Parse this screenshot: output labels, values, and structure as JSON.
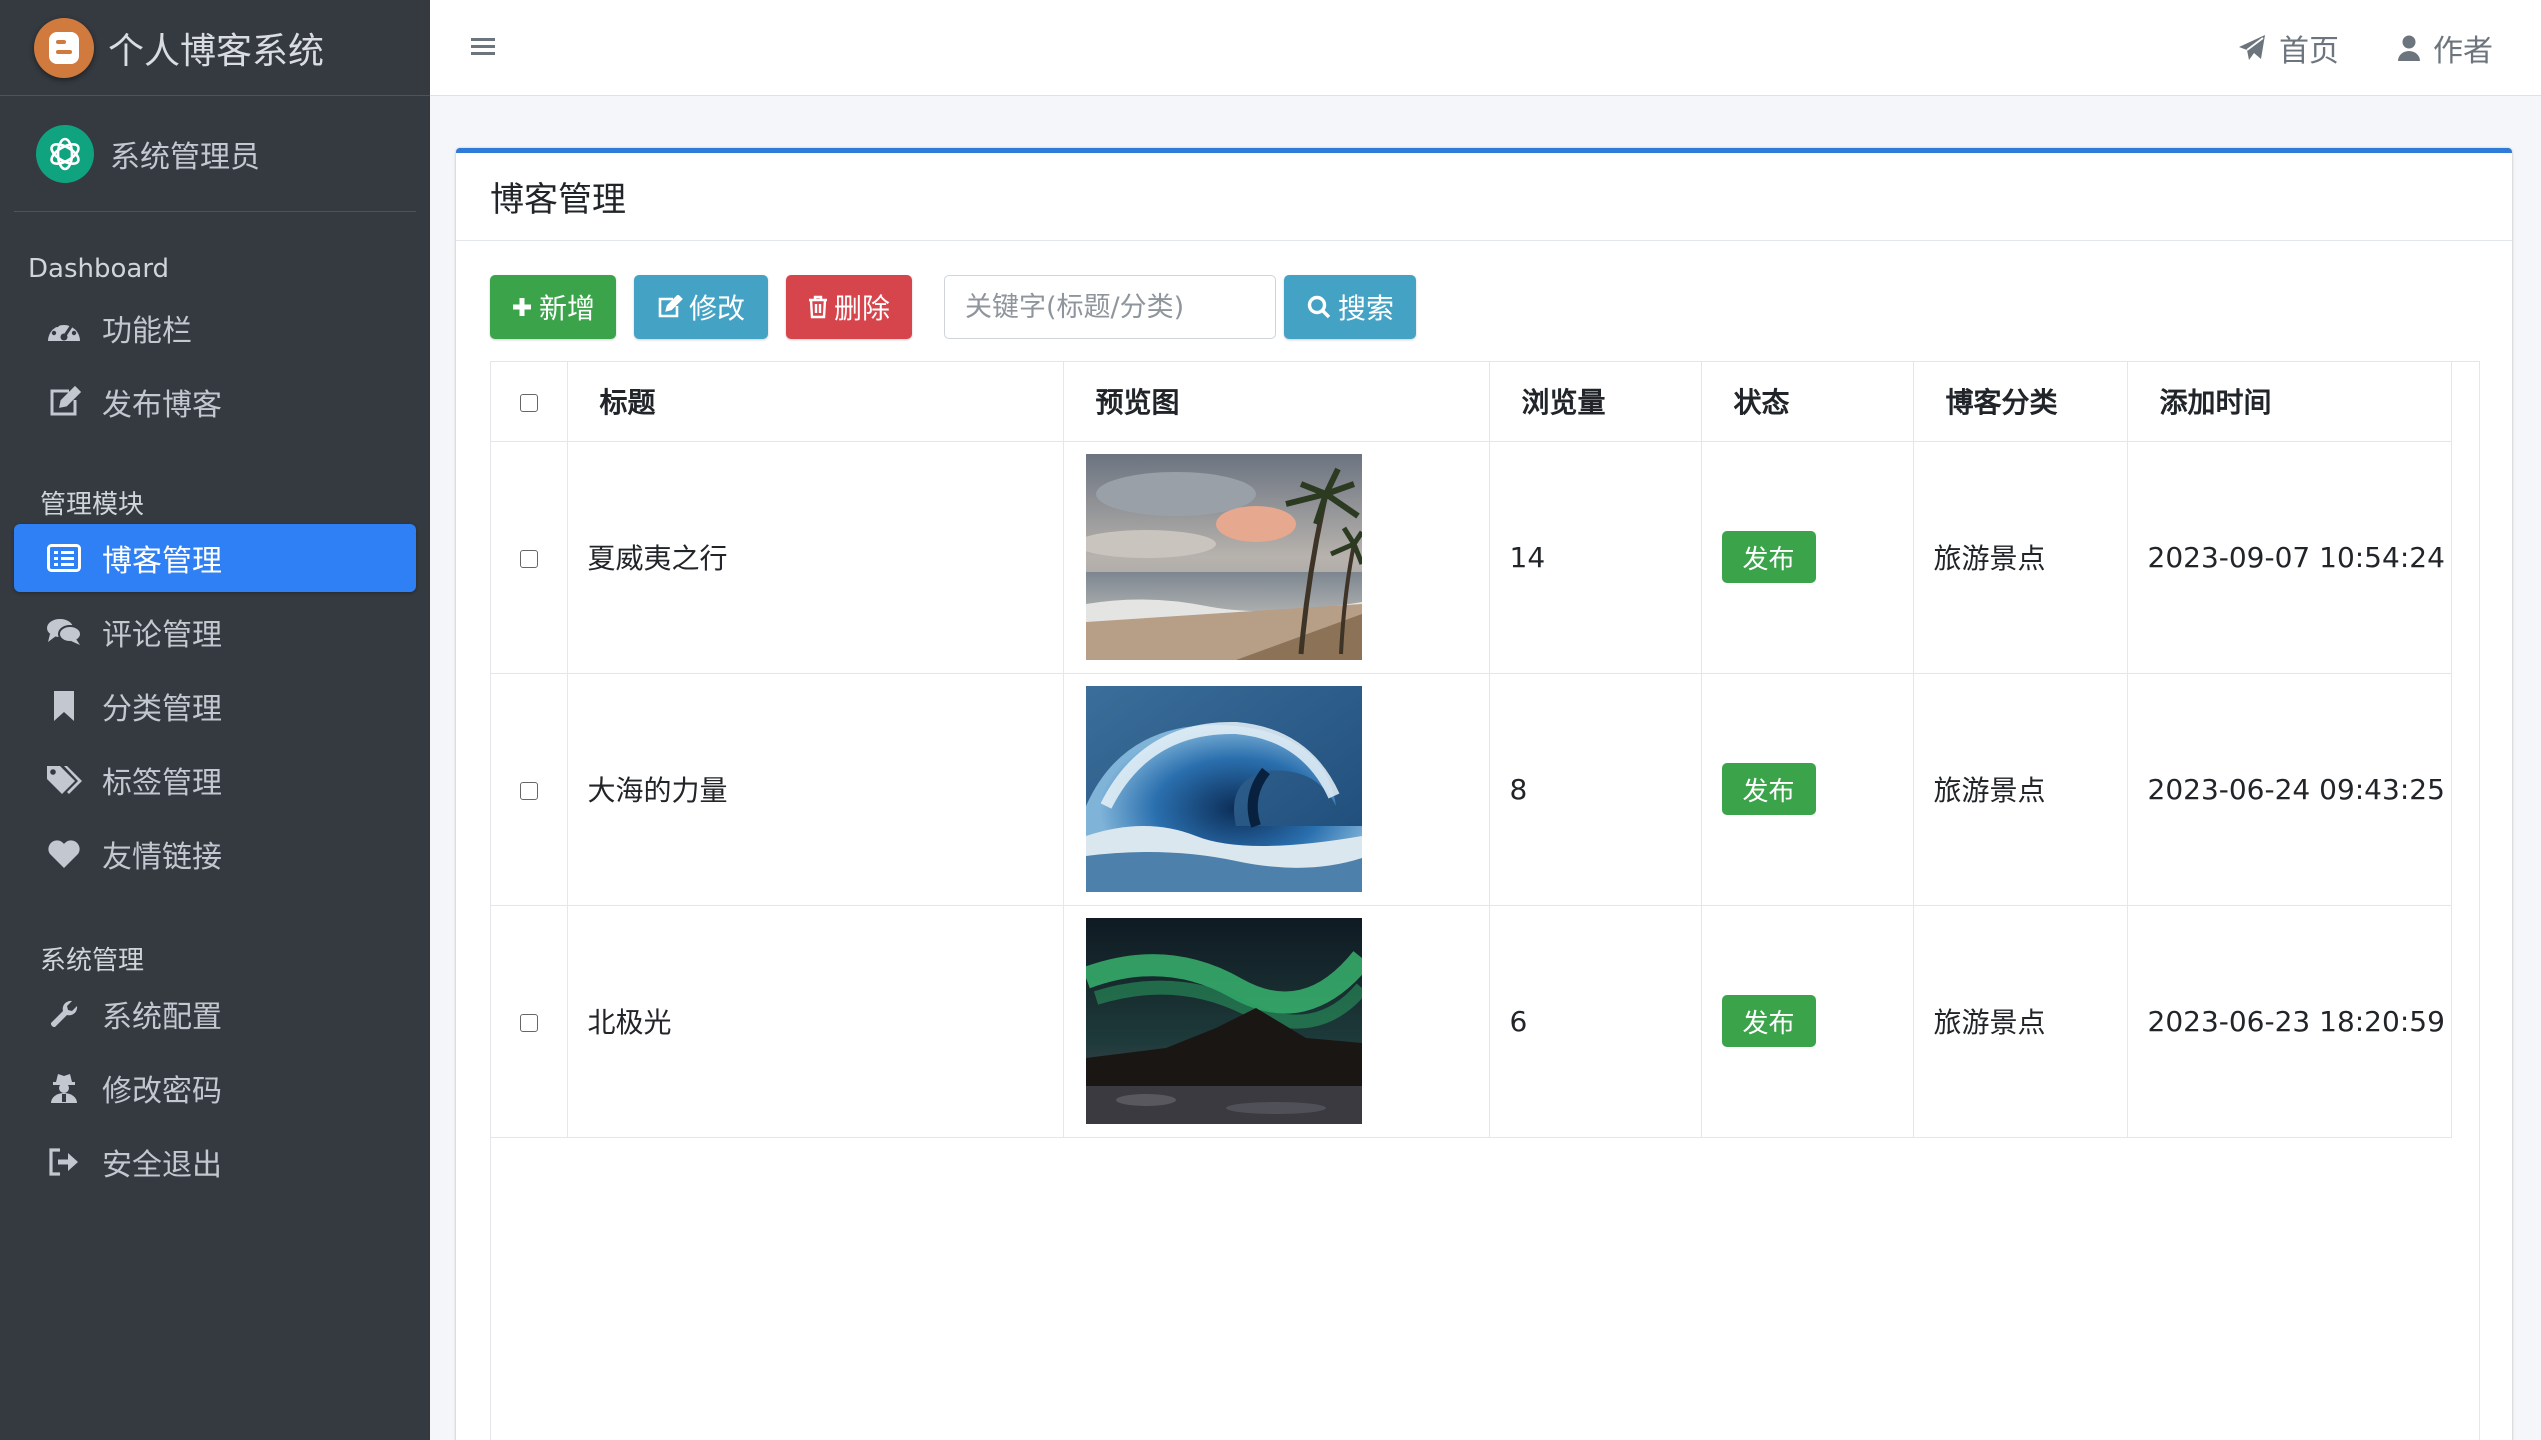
{
  "brand": {
    "title": "个人博客系统",
    "logo_icon": "blogger-icon"
  },
  "user": {
    "name": "系统管理员",
    "avatar_icon": "openai-logo-icon"
  },
  "sidebar": {
    "sections": [
      {
        "header": "Dashboard",
        "items": [
          {
            "label": "功能栏",
            "icon": "dashboard-icon"
          },
          {
            "label": "发布博客",
            "icon": "edit-icon"
          }
        ]
      },
      {
        "header": "管理模块",
        "items": [
          {
            "label": "博客管理",
            "icon": "list-icon",
            "active": true
          },
          {
            "label": "评论管理",
            "icon": "comments-icon"
          },
          {
            "label": "分类管理",
            "icon": "bookmark-icon"
          },
          {
            "label": "标签管理",
            "icon": "tags-icon"
          },
          {
            "label": "友情链接",
            "icon": "heart-icon"
          }
        ]
      },
      {
        "header": "系统管理",
        "items": [
          {
            "label": "系统配置",
            "icon": "wrench-icon"
          },
          {
            "label": "修改密码",
            "icon": "user-secret-icon"
          },
          {
            "label": "安全退出",
            "icon": "sign-out-icon"
          }
        ]
      }
    ]
  },
  "topbar": {
    "menu_icon": "bars-icon",
    "links": [
      {
        "label": "首页",
        "icon": "paper-plane-icon"
      },
      {
        "label": "作者",
        "icon": "user-icon"
      }
    ]
  },
  "card": {
    "title": "博客管理",
    "toolbar": {
      "add_label": "新增",
      "edit_label": "修改",
      "delete_label": "删除",
      "search_placeholder": "关键字(标题/分类)",
      "search_value": "",
      "search_label": "搜索"
    },
    "table": {
      "columns": [
        "标题",
        "预览图",
        "浏览量",
        "状态",
        "博客分类",
        "添加时间"
      ],
      "rows": [
        {
          "title": "夏威夷之行",
          "image": "beach-palm-trees-photo",
          "views": "14",
          "status": "发布",
          "category": "旅游景点",
          "created": "2023-09-07 10:54:24"
        },
        {
          "title": "大海的力量",
          "image": "ocean-wave-photo",
          "views": "8",
          "status": "发布",
          "category": "旅游景点",
          "created": "2023-06-24 09:43:25"
        },
        {
          "title": "北极光",
          "image": "aurora-night-photo",
          "views": "6",
          "status": "发布",
          "category": "旅游景点",
          "created": "2023-06-23 18:20:59"
        }
      ]
    }
  },
  "colors": {
    "sidebar_bg": "#343a40",
    "active_item": "#2f80f4",
    "success": "#3ba44a",
    "info": "#44a3c5",
    "danger": "#d7454c",
    "card_top_border": "#2f7bd8"
  }
}
